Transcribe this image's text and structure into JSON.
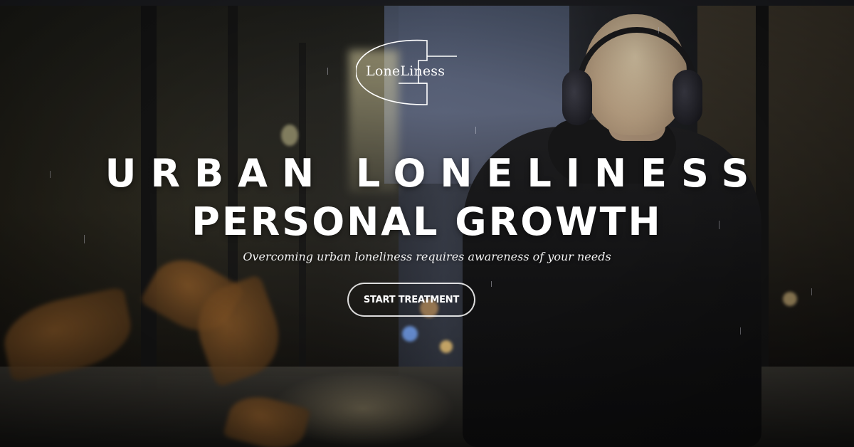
{
  "logo": {
    "text": "LoneLiness",
    "stroke_color": "#ffffff"
  },
  "hero": {
    "headline_line1": "URBAN LONELINESS",
    "headline_line2": "PERSONAL GROWTH",
    "tagline": "Overcoming urban loneliness requires awareness of your needs",
    "cta_label": "START TREATMENT"
  },
  "colors": {
    "text": "#ffffff",
    "button_border": "#ffffff"
  }
}
